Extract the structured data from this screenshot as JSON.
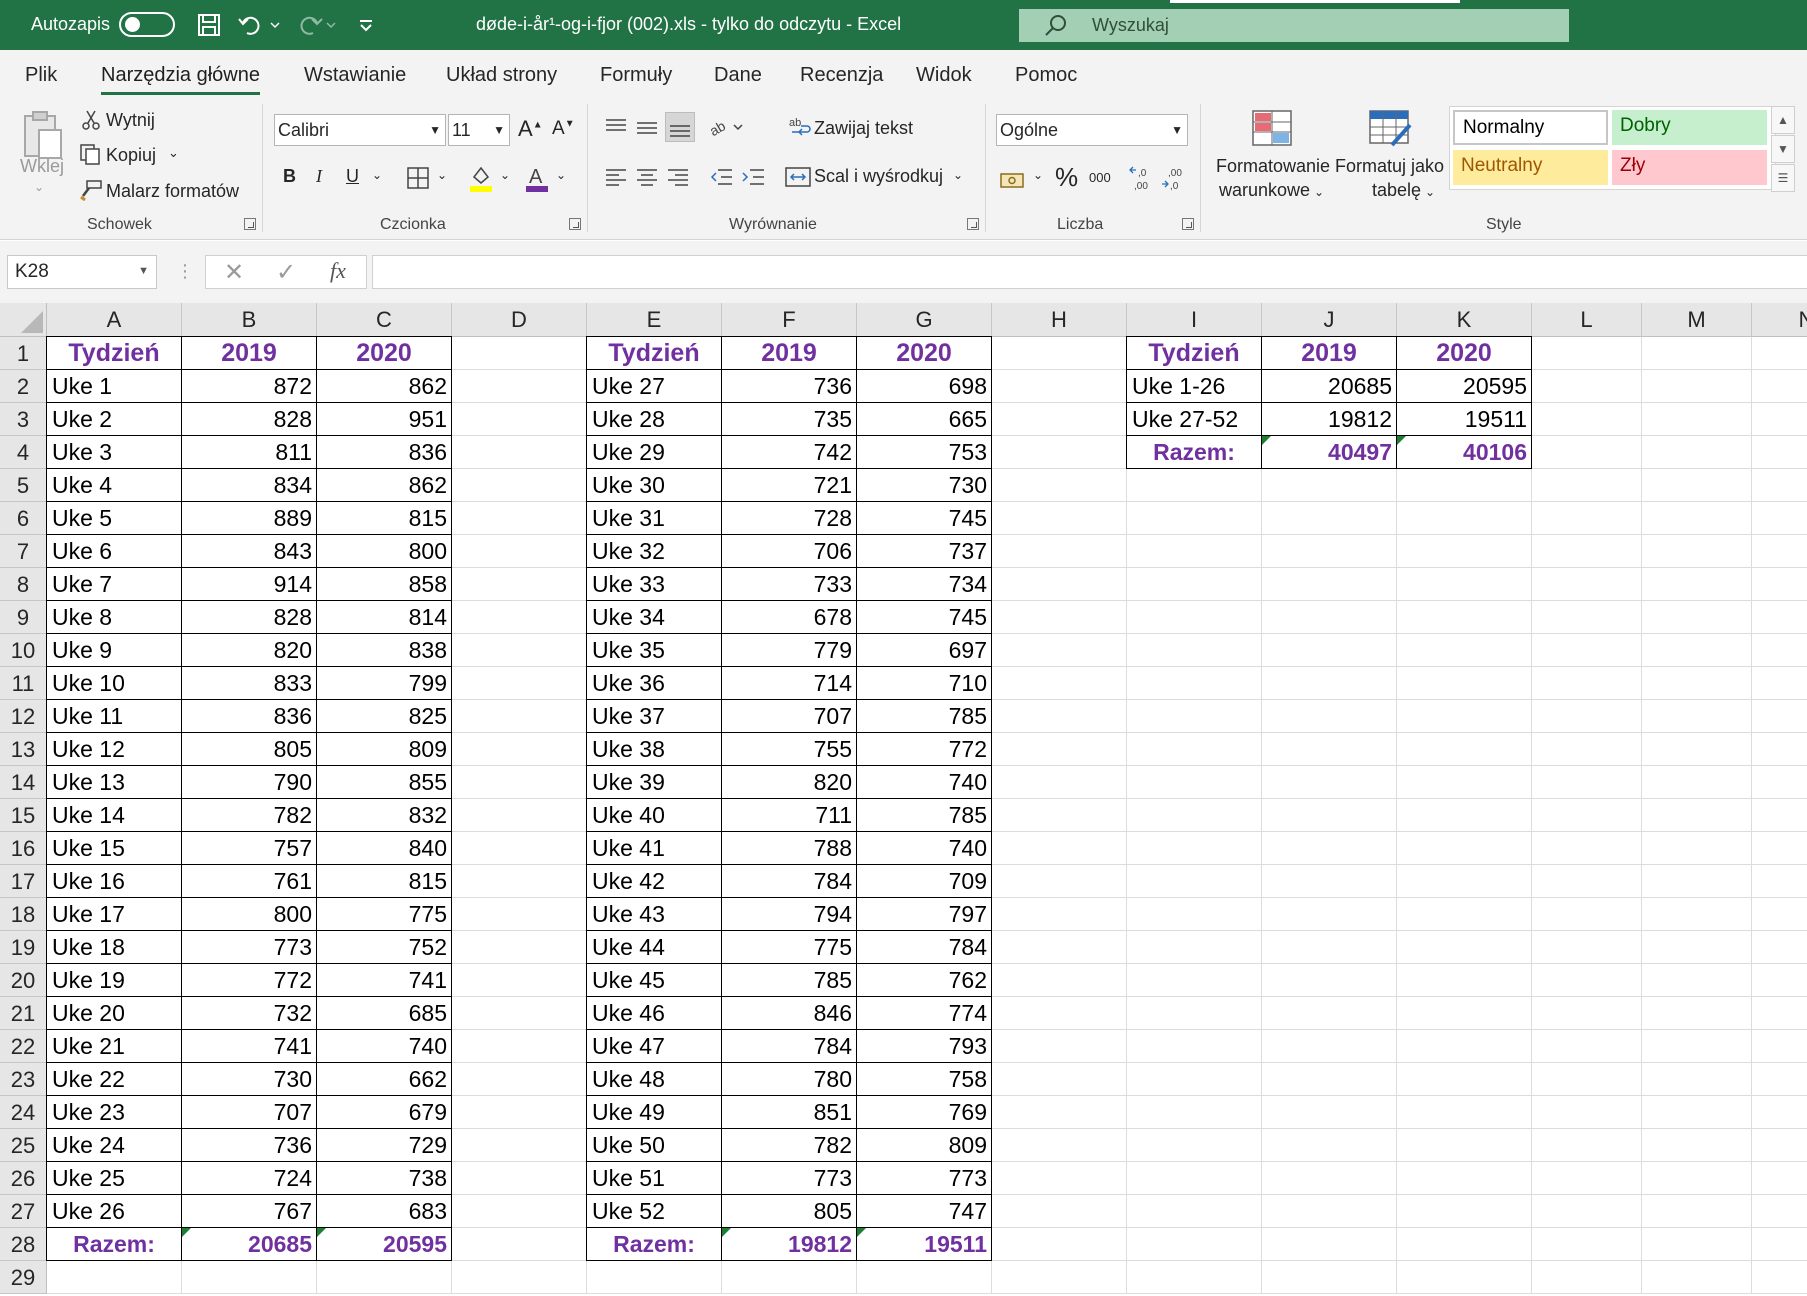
{
  "titlebar": {
    "autosave_label": "Autozapis",
    "title": "døde-i-år¹-og-i-fjor (002).xls  -  tylko do odczytu  -  Excel",
    "search_placeholder": "Wyszukaj"
  },
  "tabs": [
    "Plik",
    "Narzędzia główne",
    "Wstawianie",
    "Układ strony",
    "Formuły",
    "Dane",
    "Recenzja",
    "Widok",
    "Pomoc"
  ],
  "active_tab": "Narzędzia główne",
  "ribbon": {
    "clipboard": {
      "paste": "Wklej",
      "cut": "Wytnij",
      "copy": "Kopiuj",
      "painter": "Malarz formatów",
      "group": "Schowek"
    },
    "font": {
      "name": "Calibri",
      "size": "11",
      "bold": "B",
      "italic": "I",
      "underline": "U",
      "group": "Czcionka"
    },
    "alignment": {
      "wrap": "Zawijaj tekst",
      "merge": "Scal i wyśrodkuj",
      "group": "Wyrównanie"
    },
    "number": {
      "format": "Ogólne",
      "percent": "%",
      "thousands": "000",
      "group": "Liczba"
    },
    "styles": {
      "conditional_line1": "Formatowanie",
      "conditional_line2": "warunkowe",
      "table_line1": "Formatuj jako",
      "table_line2": "tabelę",
      "normal": "Normalny",
      "good": "Dobry",
      "neutral": "Neutralny",
      "bad": "Zły",
      "group": "Style"
    }
  },
  "formula_bar": {
    "name_box": "K28",
    "formula": ""
  },
  "columns": [
    "A",
    "B",
    "C",
    "D",
    "E",
    "F",
    "G",
    "H",
    "I",
    "J",
    "K",
    "L",
    "M",
    "N"
  ],
  "rows": [
    "1",
    "2",
    "3",
    "4",
    "5",
    "6",
    "7",
    "8",
    "9",
    "10",
    "11",
    "12",
    "13",
    "14",
    "15",
    "16",
    "17",
    "18",
    "19",
    "20",
    "21",
    "22",
    "23",
    "24",
    "25",
    "26",
    "27",
    "28",
    "29"
  ],
  "table1": {
    "headers": [
      "Tydzień",
      "2019",
      "2020"
    ],
    "rows": [
      [
        "Uke 1",
        "872",
        "862"
      ],
      [
        "Uke 2",
        "828",
        "951"
      ],
      [
        "Uke 3",
        "811",
        "836"
      ],
      [
        "Uke 4",
        "834",
        "862"
      ],
      [
        "Uke 5",
        "889",
        "815"
      ],
      [
        "Uke 6",
        "843",
        "800"
      ],
      [
        "Uke 7",
        "914",
        "858"
      ],
      [
        "Uke 8",
        "828",
        "814"
      ],
      [
        "Uke 9",
        "820",
        "838"
      ],
      [
        "Uke 10",
        "833",
        "799"
      ],
      [
        "Uke 11",
        "836",
        "825"
      ],
      [
        "Uke 12",
        "805",
        "809"
      ],
      [
        "Uke 13",
        "790",
        "855"
      ],
      [
        "Uke 14",
        "782",
        "832"
      ],
      [
        "Uke 15",
        "757",
        "840"
      ],
      [
        "Uke 16",
        "761",
        "815"
      ],
      [
        "Uke 17",
        "800",
        "775"
      ],
      [
        "Uke 18",
        "773",
        "752"
      ],
      [
        "Uke 19",
        "772",
        "741"
      ],
      [
        "Uke 20",
        "732",
        "685"
      ],
      [
        "Uke 21",
        "741",
        "740"
      ],
      [
        "Uke 22",
        "730",
        "662"
      ],
      [
        "Uke 23",
        "707",
        "679"
      ],
      [
        "Uke 24",
        "736",
        "729"
      ],
      [
        "Uke 25",
        "724",
        "738"
      ],
      [
        "Uke 26",
        "767",
        "683"
      ]
    ],
    "total": [
      "Razem:",
      "20685",
      "20595"
    ]
  },
  "table2": {
    "headers": [
      "Tydzień",
      "2019",
      "2020"
    ],
    "rows": [
      [
        "Uke 27",
        "736",
        "698"
      ],
      [
        "Uke 28",
        "735",
        "665"
      ],
      [
        "Uke 29",
        "742",
        "753"
      ],
      [
        "Uke 30",
        "721",
        "730"
      ],
      [
        "Uke 31",
        "728",
        "745"
      ],
      [
        "Uke 32",
        "706",
        "737"
      ],
      [
        "Uke 33",
        "733",
        "734"
      ],
      [
        "Uke 34",
        "678",
        "745"
      ],
      [
        "Uke 35",
        "779",
        "697"
      ],
      [
        "Uke 36",
        "714",
        "710"
      ],
      [
        "Uke 37",
        "707",
        "785"
      ],
      [
        "Uke 38",
        "755",
        "772"
      ],
      [
        "Uke 39",
        "820",
        "740"
      ],
      [
        "Uke 40",
        "711",
        "785"
      ],
      [
        "Uke 41",
        "788",
        "740"
      ],
      [
        "Uke 42",
        "784",
        "709"
      ],
      [
        "Uke 43",
        "794",
        "797"
      ],
      [
        "Uke 44",
        "775",
        "784"
      ],
      [
        "Uke 45",
        "785",
        "762"
      ],
      [
        "Uke 46",
        "846",
        "774"
      ],
      [
        "Uke 47",
        "784",
        "793"
      ],
      [
        "Uke 48",
        "780",
        "758"
      ],
      [
        "Uke 49",
        "851",
        "769"
      ],
      [
        "Uke 50",
        "782",
        "809"
      ],
      [
        "Uke 51",
        "773",
        "773"
      ],
      [
        "Uke 52",
        "805",
        "747"
      ]
    ],
    "total": [
      "Razem:",
      "19812",
      "19511"
    ]
  },
  "table3": {
    "headers": [
      "Tydzień",
      "2019",
      "2020"
    ],
    "rows": [
      [
        "Uke 1-26",
        "20685",
        "20595"
      ],
      [
        "Uke 27-52",
        "19812",
        "19511"
      ]
    ],
    "total": [
      "Razem:",
      "40497",
      "40106"
    ]
  },
  "colors": {
    "excel_green": "#217346",
    "header_purple": "#7030a0"
  }
}
